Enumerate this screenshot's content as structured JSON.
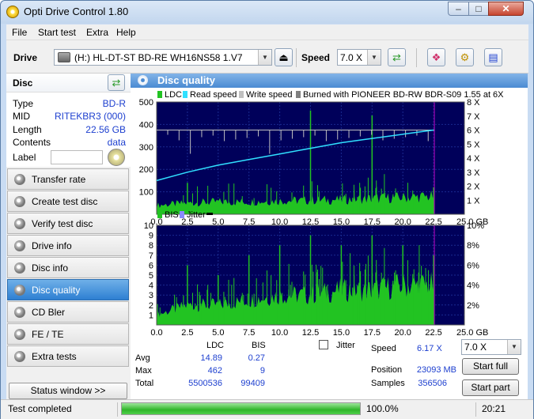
{
  "window": {
    "title": "Opti Drive Control 1.80"
  },
  "menu": [
    "File",
    "Start test",
    "Extra",
    "Help"
  ],
  "toolbar": {
    "drive_label": "Drive",
    "drive_value": "(H:)  HL-DT-ST BD-RE  WH16NS58 1.V7",
    "speed_label": "Speed",
    "speed_value": "7.0 X"
  },
  "disc": {
    "header": "Disc",
    "rows": [
      {
        "key": "Type",
        "value": "BD-R"
      },
      {
        "key": "MID",
        "value": "RITEKBR3 (000)"
      },
      {
        "key": "Length",
        "value": "22.56 GB"
      },
      {
        "key": "Contents",
        "value": "data"
      }
    ],
    "label_key": "Label"
  },
  "nav": [
    "Transfer rate",
    "Create test disc",
    "Verify test disc",
    "Drive info",
    "Disc info",
    "Disc quality",
    "CD Bler",
    "FE / TE",
    "Extra tests"
  ],
  "nav_active": 5,
  "status_window_button": "Status window >>",
  "panel": {
    "title": "Disc quality"
  },
  "chart_data": [
    {
      "type": "line",
      "legend": [
        "LDC",
        "Read speed",
        "Write speed",
        "Burned with PIONEER BD-RW   BDR-S09 1.55 at 6X"
      ],
      "colors": {
        "ldc": "#22c322",
        "read_speed": "#30e0ff",
        "write_speed": "#c0c0c0",
        "background": "#00005a"
      },
      "xlim": [
        0,
        25
      ],
      "xunit": "GB",
      "x_ticks": [
        "0.0",
        "2.5",
        "5.0",
        "7.5",
        "10.0",
        "12.5",
        "15.0",
        "17.5",
        "20.0",
        "22.5",
        "25.0 GB"
      ],
      "ylim_left": [
        0,
        500
      ],
      "y_ticks_left": [
        "100",
        "200",
        "300",
        "400",
        "500"
      ],
      "ylim_right": [
        0,
        8
      ],
      "y_ticks_right": [
        "1 X",
        "2 X",
        "3 X",
        "4 X",
        "5 X",
        "6 X",
        "7 X",
        "8 X"
      ],
      "ldc_baseline": [
        [
          0,
          40
        ],
        [
          2.5,
          50
        ],
        [
          5,
          55
        ],
        [
          7.5,
          55
        ],
        [
          10,
          60
        ],
        [
          12.5,
          62
        ],
        [
          15,
          65
        ],
        [
          17.5,
          70
        ],
        [
          20,
          75
        ],
        [
          22.5,
          80
        ]
      ],
      "ldc_spikes": [
        [
          2.5,
          140
        ],
        [
          12.5,
          462
        ],
        [
          17.5,
          440
        ],
        [
          22.5,
          120
        ]
      ],
      "read_speed": [
        [
          0,
          2.4
        ],
        [
          2.5,
          3.0
        ],
        [
          5,
          3.5
        ],
        [
          7.5,
          3.9
        ],
        [
          10,
          4.3
        ],
        [
          12.5,
          4.7
        ],
        [
          15,
          5.1
        ],
        [
          17.5,
          5.4
        ],
        [
          20,
          5.7
        ],
        [
          22.5,
          6.0
        ]
      ],
      "write_speed_level": 6.0,
      "end_marker_x": 22.56
    },
    {
      "type": "line",
      "legend": [
        "BIS",
        "Jitter"
      ],
      "colors": {
        "bis": "#22c322",
        "jitter": "#8a8aff",
        "background": "#00005a"
      },
      "xlim": [
        0,
        25
      ],
      "x_ticks": [
        "0.0",
        "2.5",
        "5.0",
        "7.5",
        "10.0",
        "12.5",
        "15.0",
        "17.5",
        "20.0",
        "22.5",
        "25.0 GB"
      ],
      "ylim_left": [
        0,
        10
      ],
      "y_ticks_left": [
        "1",
        "2",
        "3",
        "4",
        "5",
        "6",
        "7",
        "8",
        "9",
        "10"
      ],
      "y_ticks_right": [
        "2%",
        "4%",
        "6%",
        "8%",
        "10%"
      ],
      "bis_baseline": [
        [
          0,
          1
        ],
        [
          2.5,
          2
        ],
        [
          5,
          2
        ],
        [
          7.5,
          2.5
        ],
        [
          10,
          3
        ],
        [
          12.5,
          3
        ],
        [
          15,
          3.5
        ],
        [
          17.5,
          3.5
        ],
        [
          20,
          4
        ],
        [
          22.5,
          4
        ]
      ],
      "bis_spikes": [
        [
          2.5,
          6
        ],
        [
          5,
          5
        ],
        [
          7.5,
          7
        ],
        [
          10,
          8
        ],
        [
          12.5,
          9
        ],
        [
          15,
          8
        ],
        [
          17.5,
          9
        ],
        [
          20,
          8
        ],
        [
          22.5,
          7
        ]
      ],
      "end_marker_x": 22.56
    }
  ],
  "stats": {
    "headers": [
      "LDC",
      "BIS"
    ],
    "rows": [
      {
        "label": "Avg",
        "ldc": "14.89",
        "bis": "0.27"
      },
      {
        "label": "Max",
        "ldc": "462",
        "bis": "9"
      },
      {
        "label": "Total",
        "ldc": "5500536",
        "bis": "99409"
      }
    ],
    "jitter_label": "Jitter",
    "speed_label": "Speed",
    "speed_value": "6.17 X",
    "position_label": "Position",
    "position_value": "23093 MB",
    "samples_label": "Samples",
    "samples_value": "356506",
    "speed_select": "7.0 X",
    "start_full": "Start full",
    "start_part": "Start part"
  },
  "statusbar": {
    "text": "Test completed",
    "progress": 1.0,
    "progress_text": "100.0%",
    "time": "20:21"
  }
}
